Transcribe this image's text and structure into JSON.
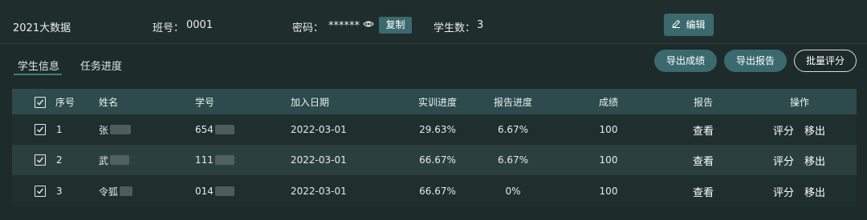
{
  "header": {
    "class_name": "2021大数据",
    "class_no_label": "班号：",
    "class_no": "0001",
    "password_label": "密码：",
    "password_mask": "******",
    "copy_label": "复制",
    "students_label": "学生数：",
    "students_count": "3",
    "edit_label": "编辑"
  },
  "tabs": [
    {
      "label": "学生信息",
      "active": true
    },
    {
      "label": "任务进度",
      "active": false
    }
  ],
  "actions": {
    "export_grades": "导出成绩",
    "export_reports": "导出报告",
    "batch_grade": "批量评分"
  },
  "table": {
    "columns": [
      "序号",
      "姓名",
      "学号",
      "加入日期",
      "实训进度",
      "报告进度",
      "成绩",
      "报告",
      "操作"
    ],
    "rows": [
      {
        "index": "1",
        "name": "张",
        "student_id": "654",
        "join_date": "2022-03-01",
        "training_progress": "29.63%",
        "report_progress": "6.67%",
        "score": "100",
        "report": "查看",
        "grade": "评分",
        "remove": "移出",
        "checked": true
      },
      {
        "index": "2",
        "name": "武",
        "student_id": "111",
        "join_date": "2022-03-01",
        "training_progress": "66.67%",
        "report_progress": "6.67%",
        "score": "100",
        "report": "查看",
        "grade": "评分",
        "remove": "移出",
        "checked": true
      },
      {
        "index": "3",
        "name": "令狐",
        "student_id": "014",
        "join_date": "2022-03-01",
        "training_progress": "66.67%",
        "report_progress": "0%",
        "score": "100",
        "report": "查看",
        "grade": "评分",
        "remove": "移出",
        "checked": true
      }
    ]
  },
  "colors": {
    "background": "#1d2b2a",
    "accent": "#3a6a6e",
    "table_header": "#2d4a4c",
    "row_alt": "#2b3f3e"
  }
}
